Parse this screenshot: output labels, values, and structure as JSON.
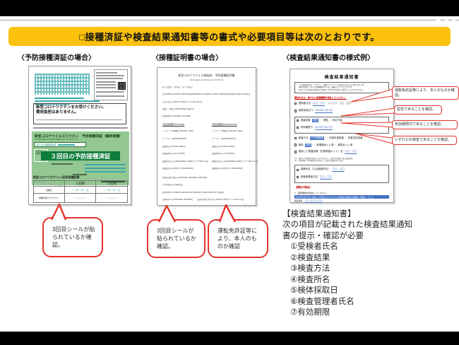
{
  "banner": {
    "text": "□接種済証や検査結果通知書等の書式や必要項目等は次のとおりです。"
  },
  "headers": {
    "col1": "〈予防接種済証の場合〉",
    "col2": "〈接種証明書の場合〉",
    "col3": "〈検査結果通知書の様式例〉"
  },
  "doc1": {
    "notice1": "新型コロナワクチンをお受けください。",
    "notice2": "費用負担はありません。",
    "green_title": "新型コロナウイルスワクチン　予防接種済証（臨時接種）",
    "green_sub": "Certificate of Vaccination for COVID-19",
    "ticket_label": "あなたの接種券番号",
    "cell_line1": "３回目",
    "cell_line2": "接種年月日",
    "badge": "３回目の予防接種済証",
    "record_title": "新型コロナワクチン1,2回目接種記録",
    "table": {
      "col1": "１回目",
      "col2": "２回目",
      "row1": "接種日",
      "row2": "接種を受けたワクチン",
      "date1": "○○○○年 ○○月 ○○日",
      "date2": "○○○○年 ○○月 ○○日",
      "vac1": "○○○○○○○○○",
      "vac2": "○○○○○○○○○"
    }
  },
  "doc2": {
    "title_jp": "新型コロナウイルス感染症　予防接種証明書",
    "title_en": "Vaccination Certificate of COVID-19",
    "fields": [
      "姓（旧姓）（別姓）・名（別名）",
      "[Surname(Former surname)(Alternative surname) Given name(Alternative given name)]",
      "生年月日 [Date of Birth(YYYY-MM-DD)]",
      "国籍・地域 [Nationality/Region]",
      "旅券番号 [Passport Number]"
    ],
    "dose1_header": "1回目接種(First Dose)",
    "dose2_header": "2回目接種(Second Dose)",
    "dose_fields": [
      "ワクチンの種類 [Vaccine Type]",
      "メーカー [Manufacturer]",
      "製品名 [Product Name]",
      "製造番号 [Lot Number]",
      "接種年月日 [Vaccination Date(YYYY-MM-DD)]",
      "接種国 [Country of Vaccination]"
    ],
    "footer": [
      "証明書発行者 [Certificate Issuance Authority]",
      "日本国厚生労働大臣",
      "[Minister of Health,Labour and Welfare,Government of Japan]",
      "証明書ID [Certificate Identifier]　　証明書発行年月日 [Issue Date(YYYY-MM-DD)]"
    ]
  },
  "doc3": {
    "title": "検査結果通知書",
    "bullets": [
      "・ この検査結果は、「ワクチン・検査パッケージ」制度等に用いるためのものです。",
      "・ 陽性の際は、追って医療機関等からもご連絡させていただきます。",
      "・ 新型コロナ感染症の罹患の有無をこれ以外の目的に活用することはできません。"
    ],
    "warning": "陽性の方は、速やかに医療機関を受診してください。",
    "r1_label": "受検者氏名",
    "r1_value": "〇〇　〇〇",
    "r1_extra": "（フリガナ　〇〇　〇〇）",
    "r2_label": "検体採取日*1",
    "r2_value": "2021年〇月〇日",
    "r3_label": "検査結果",
    "r3_pick": "陰性",
    "r3_rest": "・ 陽性 ・ 判定不能",
    "r4_label": "有効期限*2",
    "r4_value": "2021年〇月〇日",
    "r5_label": "検査方法",
    "r5_pick": "PCR検査等",
    "r5_rest": "・ 抗原定量検査 ・ 抗原定性検査",
    "r6_label": "検体",
    "r6_pick": "唾液",
    "r6_rest": "・ 鼻咽頭ぬぐい液 ・ 鼻腔ぬぐい液",
    "r7_label": "使用した検査試薬（抗原検査キット）名",
    "r7_value": "〇〇、〇〇",
    "note1": "※1　検査のため検体を採取した年月日を記入。抗原定性検査の場合は結果日。",
    "note2": "※2　有効期限（PCR検査等は3日以内、抗原定性検査は1日以内）",
    "o1_label": "事業所名（又は検査所名）",
    "o1_value": "〇〇、〇〇",
    "o2_label": "検査管理者氏名",
    "o2_value": "〇〇、〇〇",
    "pos_heading": "【陽性の場合】",
    "pos_line1": "□　医療機関を受診してください。",
    "pos_line2": "2021年〇月〇日に実施した新型コロナウイルス感染症の検査の結果は「陽性」でした。",
    "pos_line3_label": "検査番号　",
    "pos_line3_value": "〇〇-〇〇〇〇-〇〇"
  },
  "callouts": [
    "運転免許証等により、本人のものか確認。",
    "陰性であることを確認。",
    "有効期限内であることを確認。",
    "いずれかの検査であることを確認。"
  ],
  "bubbles": [
    "3回目シールが貼られているか確認。",
    "3回目シールが貼られているか確認。",
    "運転免許証等により、本人のものか確認"
  ],
  "info": {
    "heading": "【検査結果通知書】",
    "lead1": "次の項目が記載された検査結果通知",
    "lead2": "書の提示・確認が必要",
    "items": [
      "①受検者氏名",
      "②検査結果",
      "③検査方法",
      "④検査所名",
      "⑤検体採取日",
      "⑥検査管理者氏名",
      "⑦有効期限"
    ]
  }
}
